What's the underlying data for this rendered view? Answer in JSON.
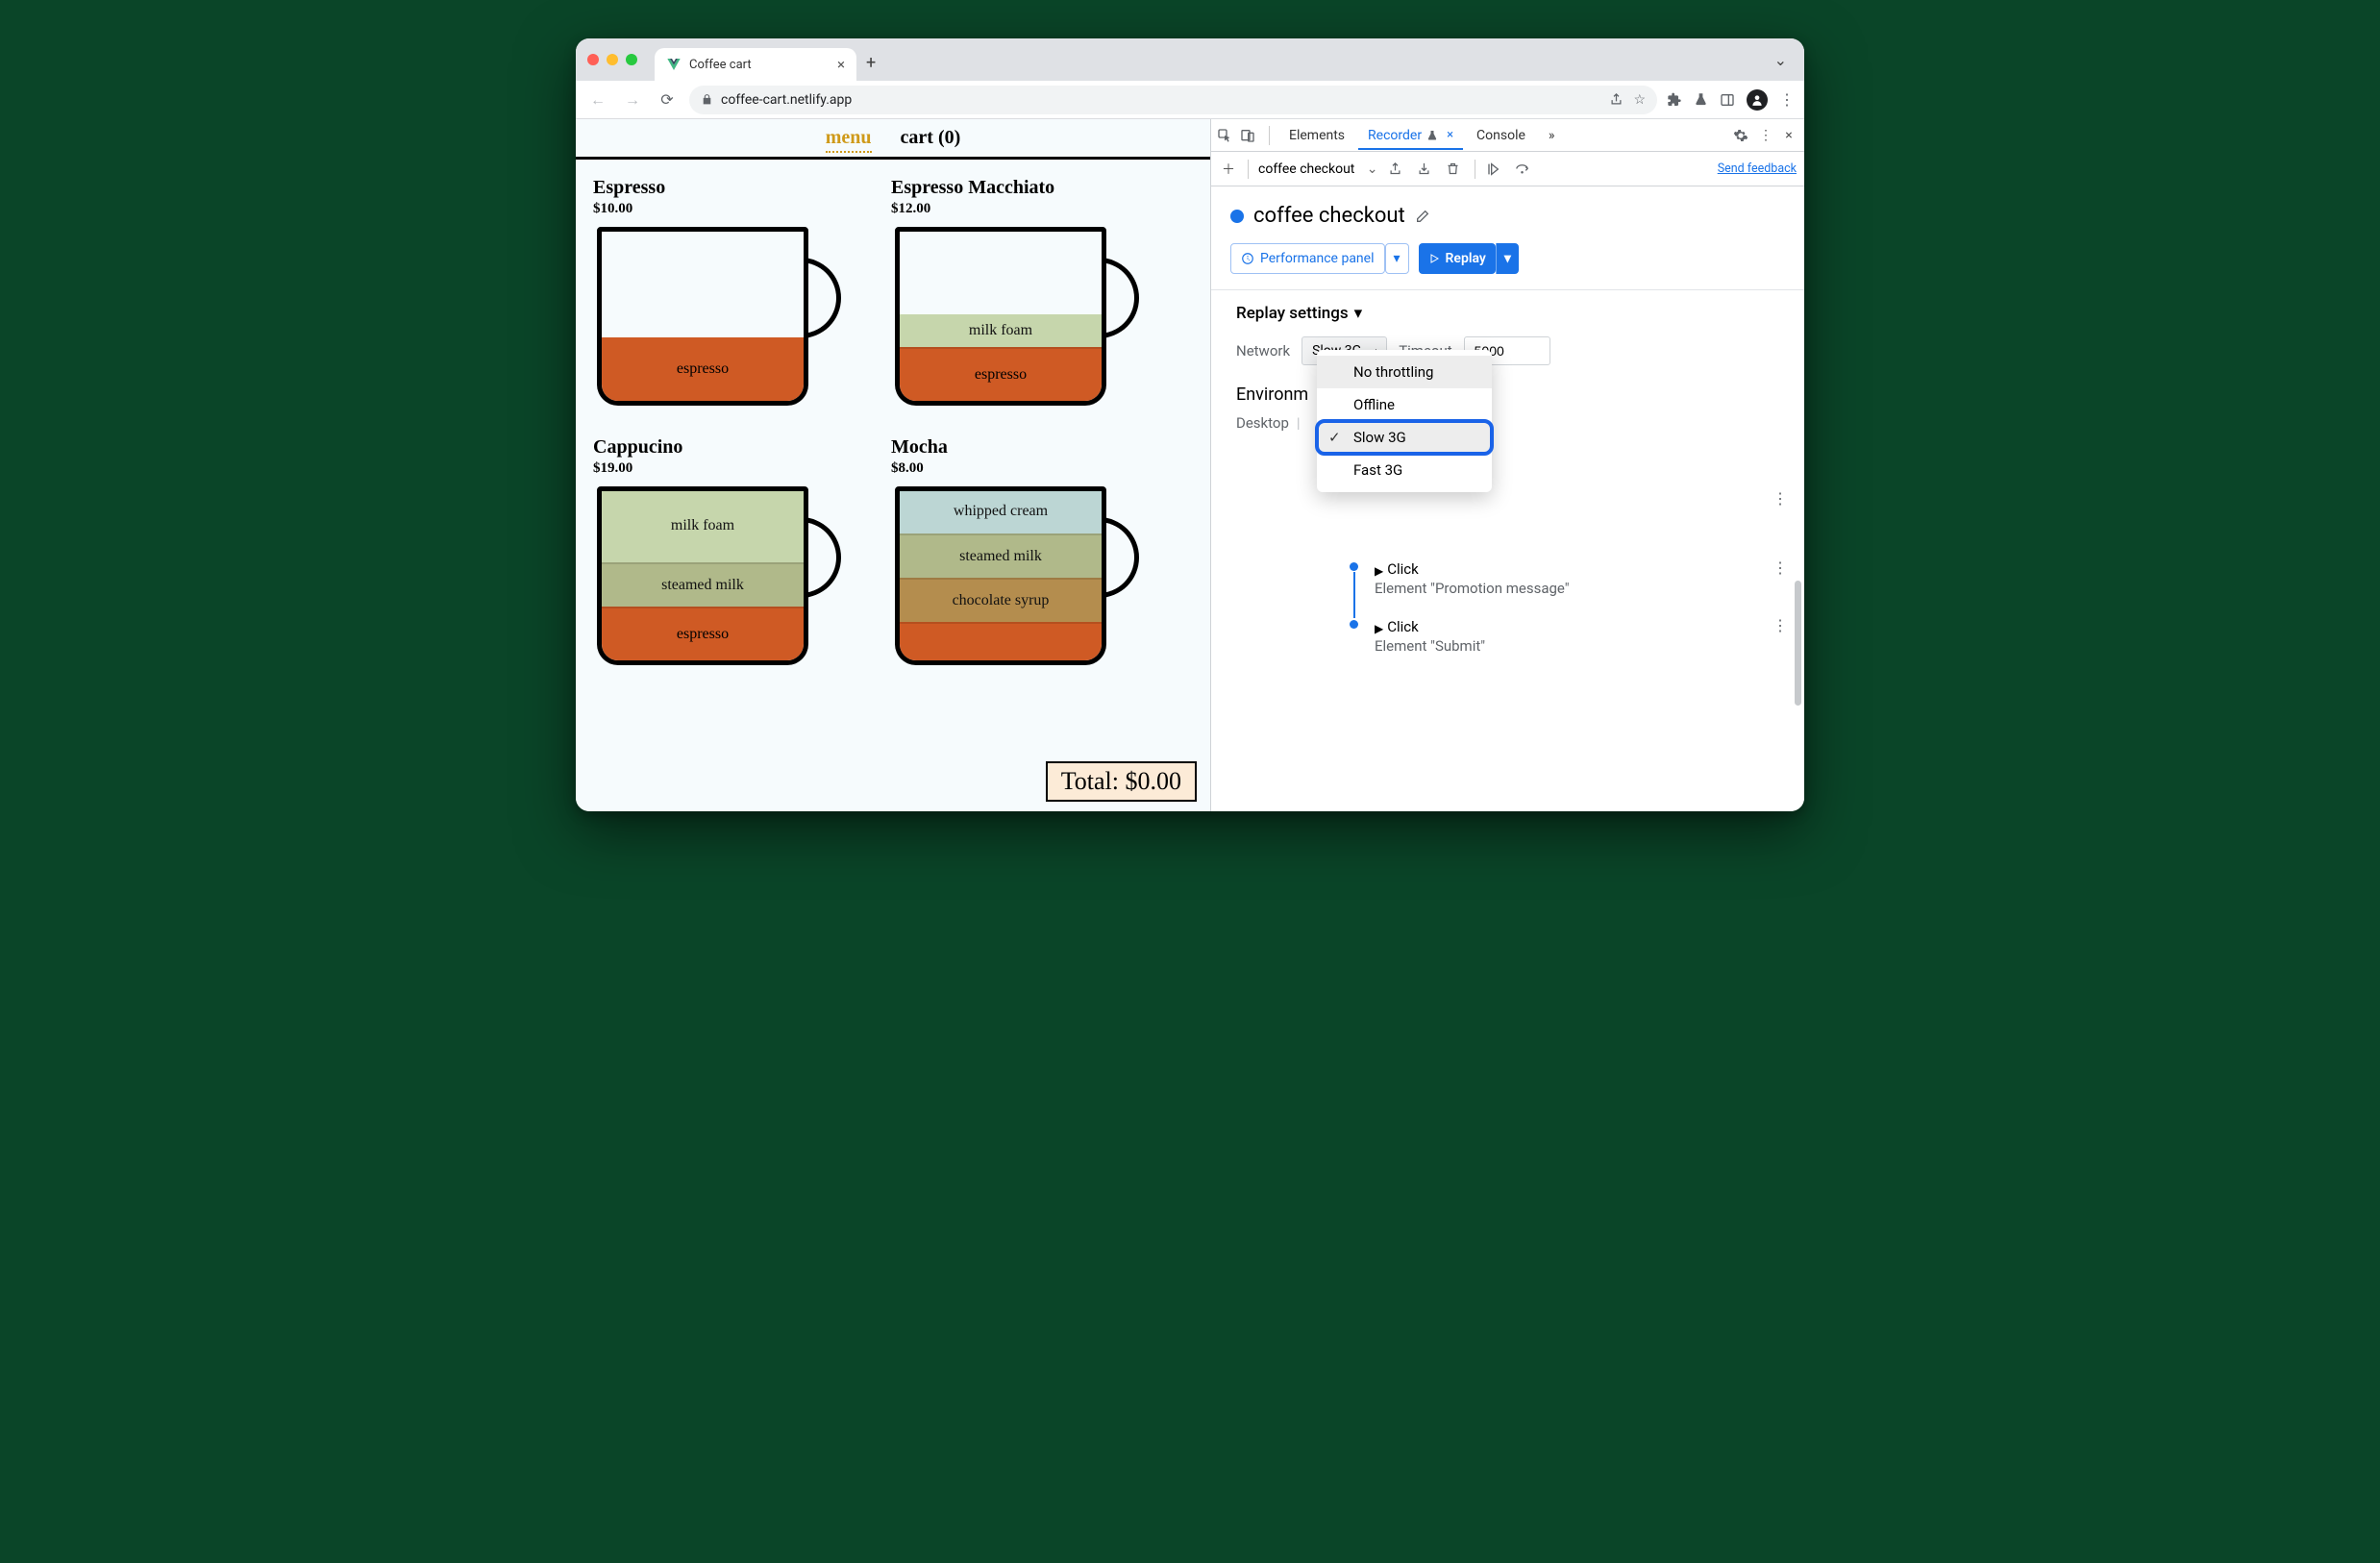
{
  "browser": {
    "tab_title": "Coffee cart",
    "url": "coffee-cart.netlify.app"
  },
  "page": {
    "nav_menu": "menu",
    "nav_cart": "cart (0)",
    "products": [
      {
        "name": "Espresso",
        "price": "$10.00"
      },
      {
        "name": "Espresso Macchiato",
        "price": "$12.00"
      },
      {
        "name": "Cappucino",
        "price": "$19.00"
      },
      {
        "name": "Mocha",
        "price": "$8.00"
      }
    ],
    "layers": {
      "espresso": "espresso",
      "milk_foam": "milk foam",
      "steamed_milk": "steamed milk",
      "whipped_cream": "whipped cream",
      "chocolate_syrup": "chocolate syrup"
    },
    "total": "Total: $0.00"
  },
  "devtools": {
    "tabs": {
      "elements": "Elements",
      "recorder": "Recorder",
      "console": "Console"
    },
    "toolbar": {
      "recording_name": "coffee checkout",
      "send_feedback": "Send feedback"
    },
    "title": "coffee checkout",
    "perf_btn": "Performance panel",
    "replay_btn": "Replay",
    "settings": {
      "heading": "Replay settings",
      "network_label": "Network",
      "network_value": "Slow 3G",
      "timeout_label": "Timeout",
      "timeout_value": "5000",
      "env_heading": "Environm",
      "env_value": "Desktop"
    },
    "dropdown": {
      "no_throttling": "No throttling",
      "offline": "Offline",
      "slow_3g": "Slow 3G",
      "fast_3g": "Fast 3G"
    },
    "steps": [
      {
        "title": "Click",
        "sub": "Element \"Promotion message\""
      },
      {
        "title": "Click",
        "sub": "Element \"Submit\""
      }
    ]
  }
}
